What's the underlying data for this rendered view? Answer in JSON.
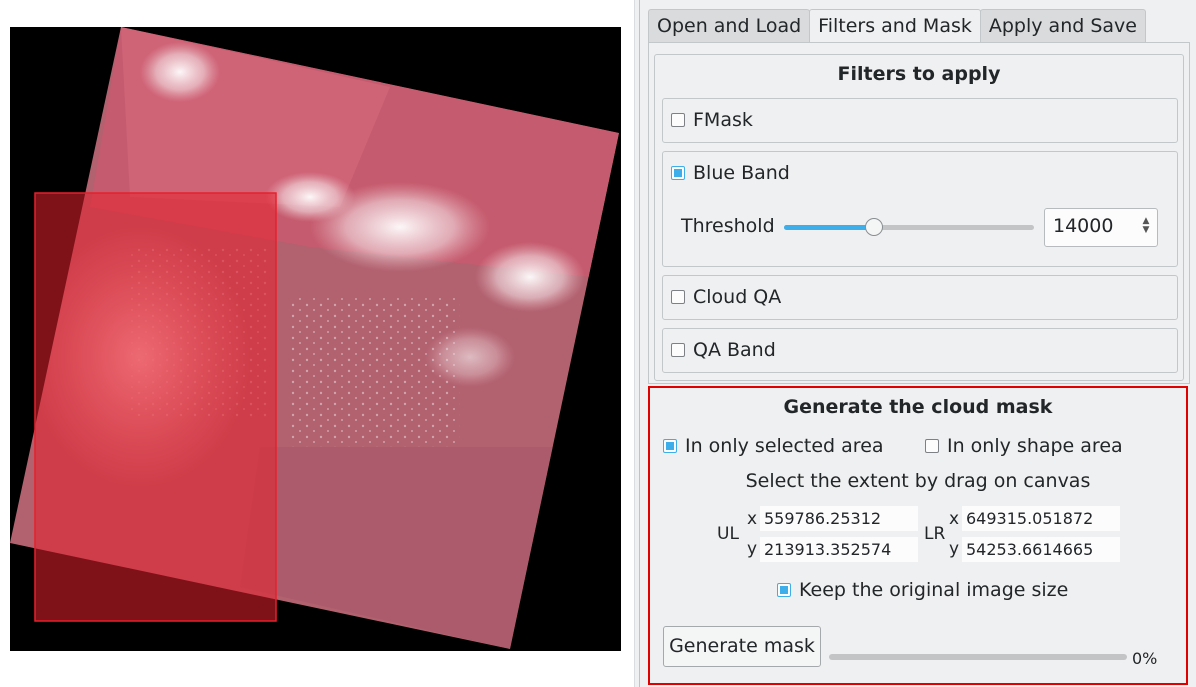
{
  "tabs": [
    {
      "label": "Open and Load",
      "active": false
    },
    {
      "label": "Filters and Mask",
      "active": true
    },
    {
      "label": "Apply and Save",
      "active": false
    }
  ],
  "filters": {
    "title": "Filters to apply",
    "fmask": {
      "label": "FMask",
      "checked": false
    },
    "blue_band": {
      "label": "Blue Band",
      "checked": true,
      "threshold_label": "Threshold",
      "threshold_value": "14000",
      "slider_fraction": 0.36
    },
    "cloud_qa": {
      "label": "Cloud QA",
      "checked": false
    },
    "qa_band": {
      "label": "QA Band",
      "checked": false
    }
  },
  "cloud_mask": {
    "title": "Generate the cloud mask",
    "selected_area": {
      "label": "In only selected area",
      "checked": true
    },
    "shape_area": {
      "label": "In only shape area",
      "checked": false
    },
    "extent_hint": "Select the extent by drag on canvas",
    "ul_label": "UL",
    "lr_label": "LR",
    "x_label": "x",
    "y_label": "y",
    "ul_x": "559786.25312",
    "ul_y": "213913.352574",
    "lr_x": "649315.051872",
    "lr_y": "54253.6614665",
    "keep_size": {
      "label": "Keep the original image size",
      "checked": true
    },
    "generate_button": "Generate mask",
    "progress_text": "0%",
    "progress": 0
  },
  "colors": {
    "accent": "#3daee9",
    "highlight_border": "#e00000",
    "selection_fill": "#e8202c"
  },
  "icons": {
    "spin_arrows": "up-down-arrows-icon"
  }
}
